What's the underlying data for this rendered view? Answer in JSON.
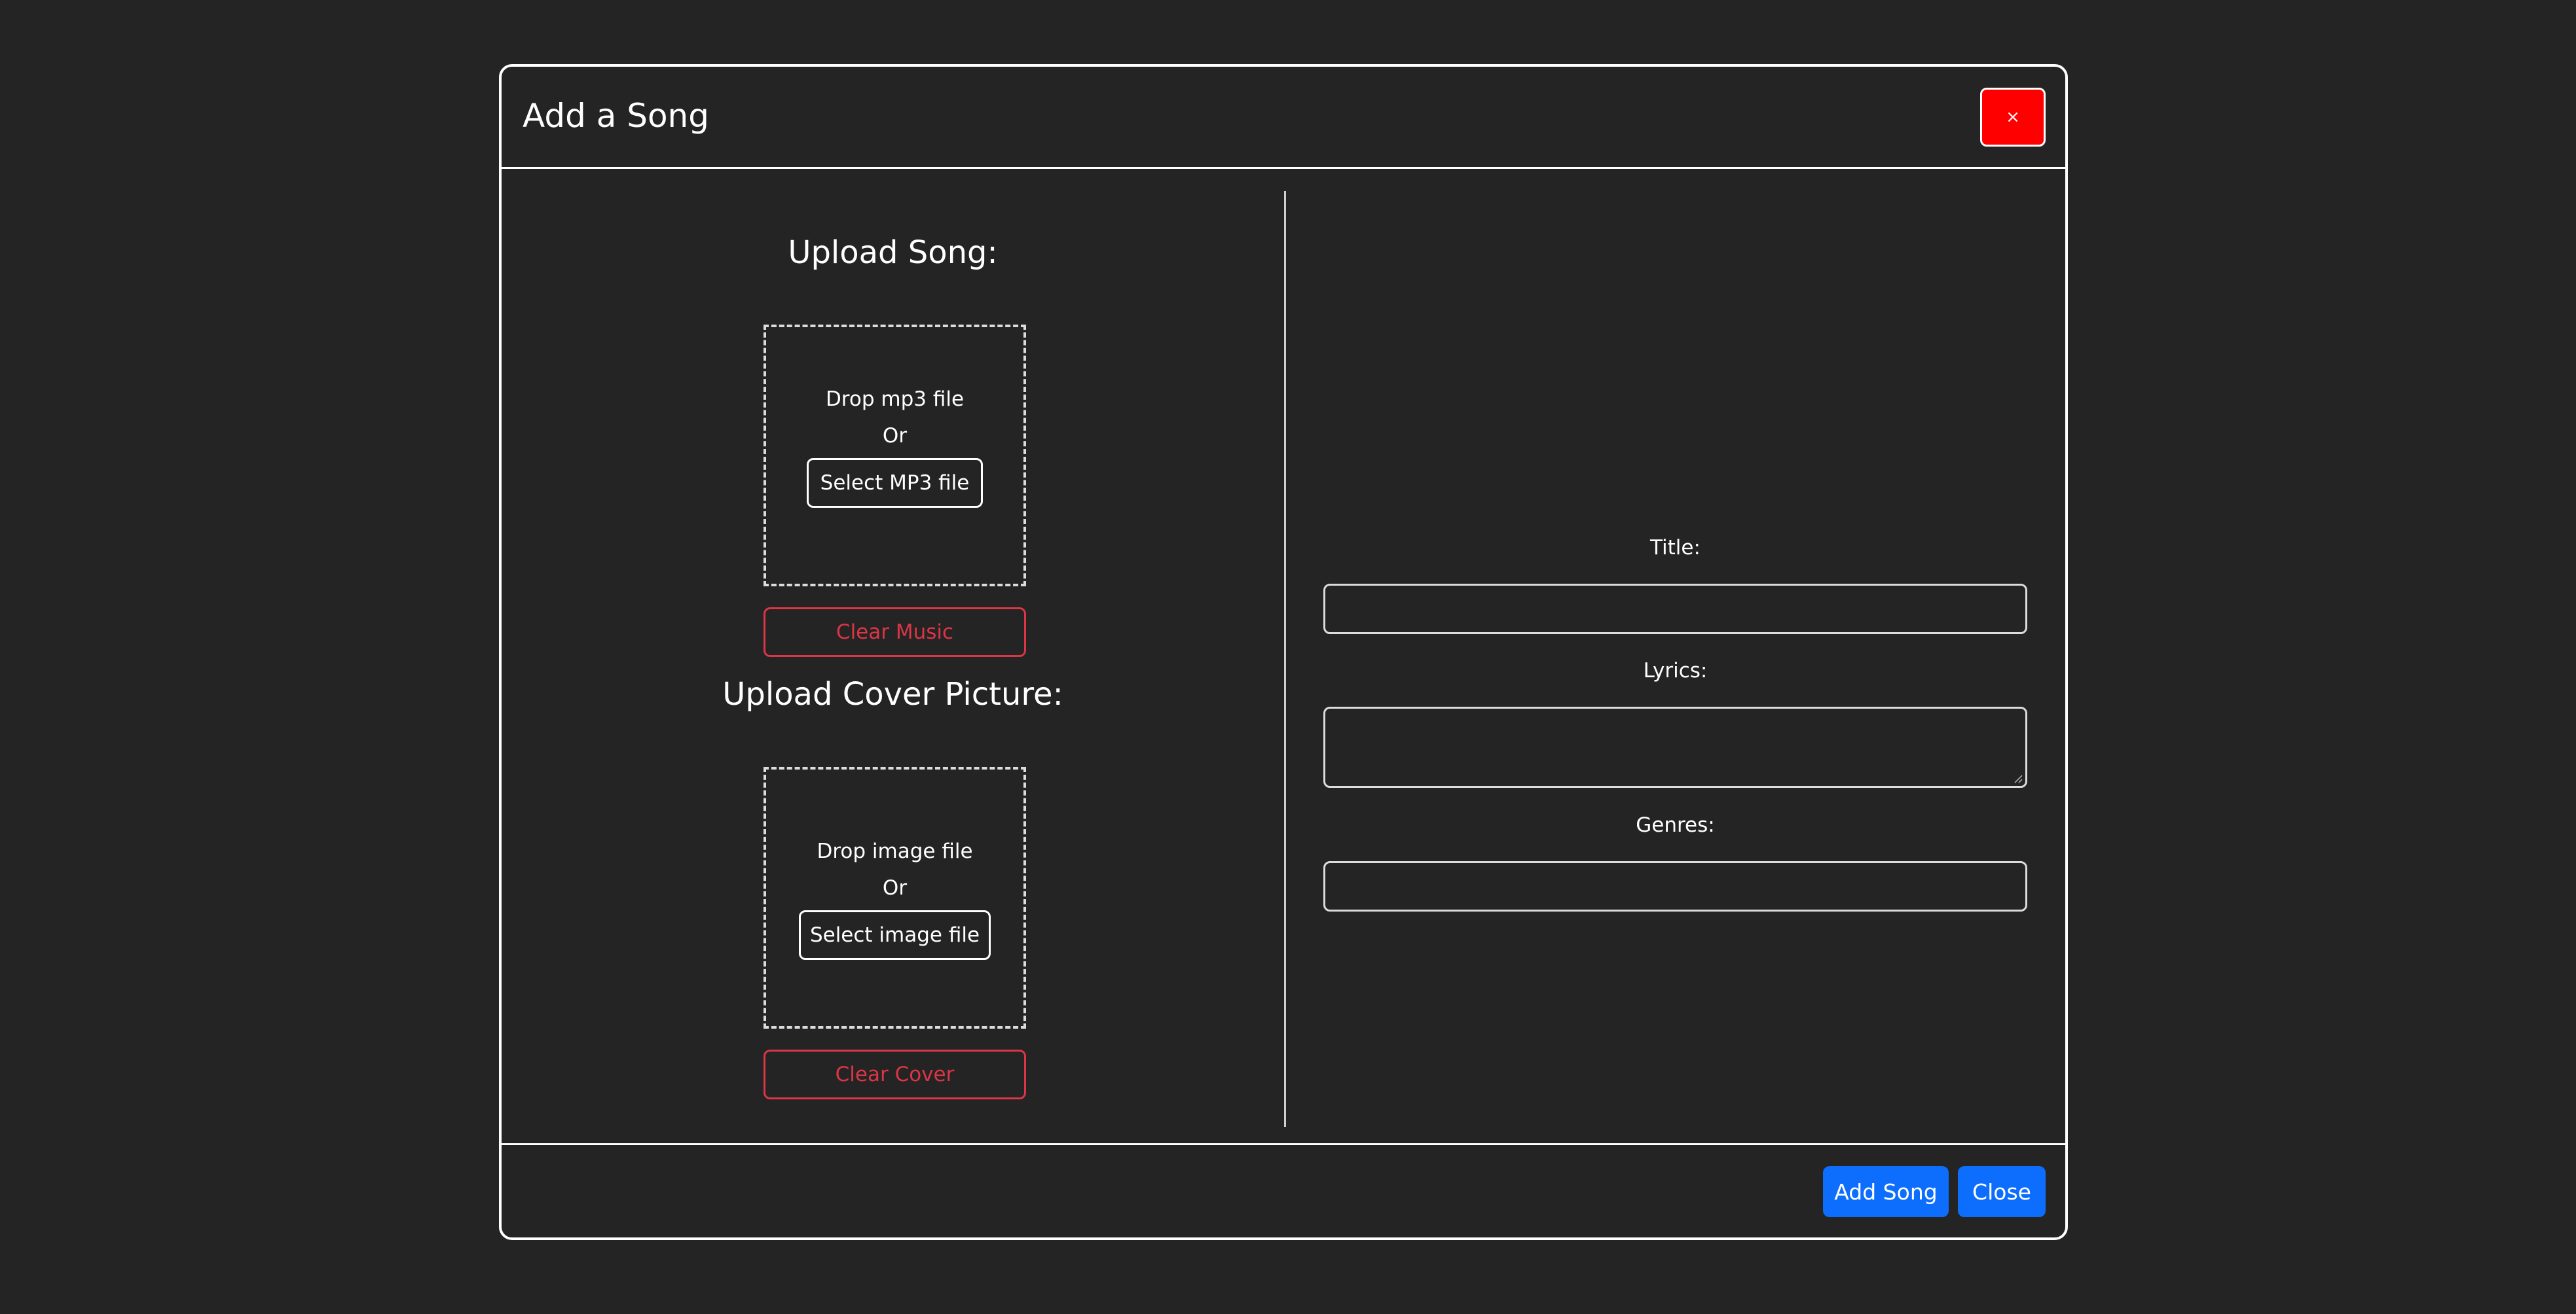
{
  "modal": {
    "title": "Add a Song",
    "close_x_label": "×"
  },
  "upload_song": {
    "heading": "Upload Song:",
    "drop_text": "Drop mp3 file",
    "or_text": "Or",
    "select_label": "Select MP3 file",
    "clear_label": "Clear Music"
  },
  "upload_cover": {
    "heading": "Upload Cover Picture:",
    "drop_text": "Drop image file",
    "or_text": "Or",
    "select_label": "Select image file",
    "clear_label": "Clear Cover"
  },
  "form": {
    "title_label": "Title:",
    "title_value": "",
    "lyrics_label": "Lyrics:",
    "lyrics_value": "",
    "genres_label": "Genres:",
    "genres_value": ""
  },
  "footer": {
    "add_label": "Add Song",
    "close_label": "Close"
  },
  "colors": {
    "background": "#242424",
    "danger": "#dc3545",
    "close_x": "#ff0000",
    "primary": "#0d6efd"
  }
}
